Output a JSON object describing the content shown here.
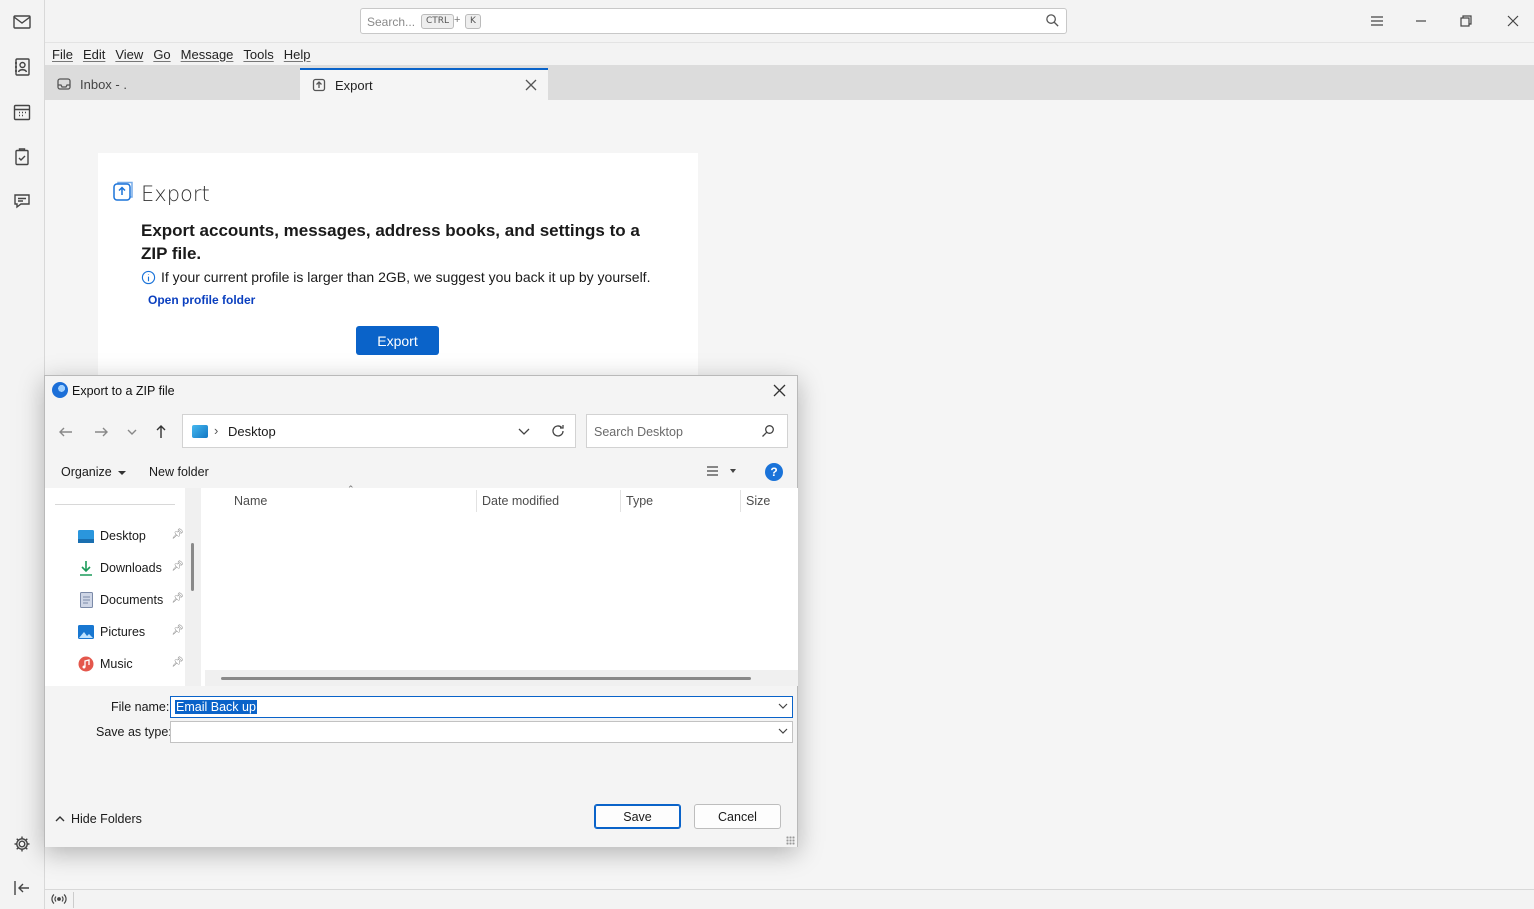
{
  "spaces": {
    "items": [
      "mail-icon",
      "address-book-icon",
      "calendar-icon",
      "tasks-icon",
      "chat-icon"
    ],
    "bottom": [
      "gear-icon",
      "collapse-icon"
    ]
  },
  "titlebar": {
    "search_placeholder": "Search...",
    "shortcut_ctrl": "CTRL",
    "shortcut_plus": "+",
    "shortcut_key": "K"
  },
  "menubar": {
    "items": [
      "File",
      "Edit",
      "View",
      "Go",
      "Message",
      "Tools",
      "Help"
    ]
  },
  "tabs": [
    {
      "label": "Inbox - ."
    },
    {
      "label": "Export"
    }
  ],
  "export_card": {
    "title": "Export",
    "heading": "Export accounts, messages, address books, and settings to a ZIP file.",
    "info": "If your current profile is larger than 2GB, we suggest you back it up by yourself.",
    "link": "Open profile folder",
    "button": "Export"
  },
  "dialog": {
    "title": "Export to a ZIP file",
    "address": "Desktop",
    "search_placeholder": "Search Desktop",
    "organize": "Organize",
    "new_folder": "New folder",
    "help": "?",
    "nav_items": [
      {
        "label": "Desktop",
        "icon": "desktop-folder-icon"
      },
      {
        "label": "Downloads",
        "icon": "download-icon"
      },
      {
        "label": "Documents",
        "icon": "documents-icon"
      },
      {
        "label": "Pictures",
        "icon": "pictures-icon"
      },
      {
        "label": "Music",
        "icon": "music-icon"
      }
    ],
    "columns": [
      "Name",
      "Date modified",
      "Type",
      "Size"
    ],
    "file_name_label": "File name:",
    "file_name_value": "Email Back up",
    "save_as_type_label": "Save as type:",
    "save_as_type_value": "",
    "hide_folders": "Hide Folders",
    "save": "Save",
    "cancel": "Cancel"
  },
  "colors": {
    "accent": "#0a63c9",
    "link": "#0a3fbf"
  }
}
